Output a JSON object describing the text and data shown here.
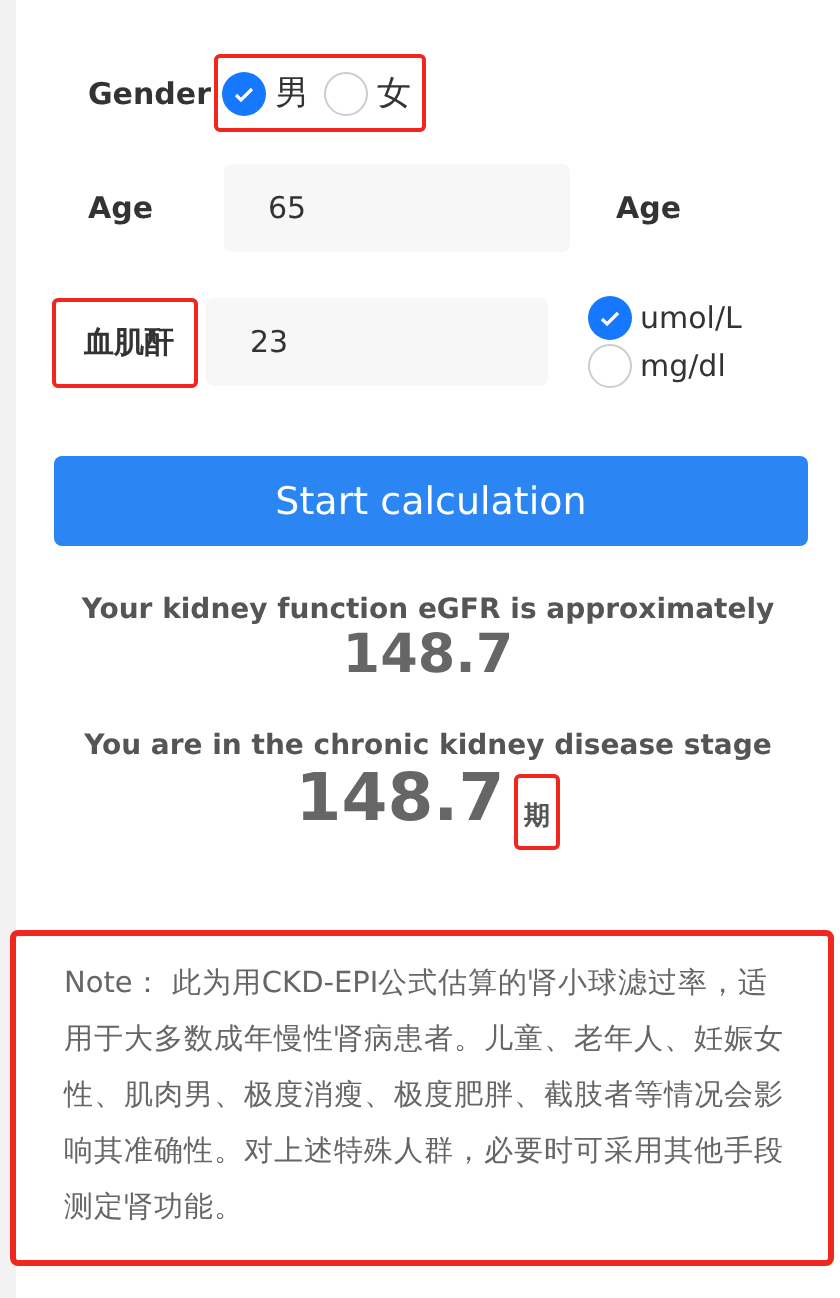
{
  "gender": {
    "label": "Gender",
    "highlighted": true,
    "options": [
      {
        "label": "男",
        "selected": true
      },
      {
        "label": "女",
        "selected": false
      }
    ]
  },
  "age": {
    "label": "Age",
    "value": "65",
    "unit_label": "Age"
  },
  "creatinine": {
    "label": "血肌酐",
    "highlighted": true,
    "value": "23",
    "units": [
      {
        "label": "umol/L",
        "selected": true
      },
      {
        "label": "mg/dl",
        "selected": false
      }
    ]
  },
  "button": "Start calculation",
  "result": {
    "egfr_label": "Your kidney function eGFR is approximately",
    "egfr_value": "148.7",
    "stage_label": "You are in the chronic kidney disease stage",
    "stage_value": "148.7",
    "stage_suffix": "期",
    "suffix_highlighted": true
  },
  "note": {
    "text": "Note： 此为用CKD-EPI公式估算的肾小球滤过率，适用于大多数成年慢性肾病患者。儿童、老年人、妊娠女性、肌肉男、极度消瘦、极度肥胖、截肢者等情况会影响其准确性。对上述特殊人群，必要时可采用其他手段测定肾功能。",
    "highlighted": true
  }
}
